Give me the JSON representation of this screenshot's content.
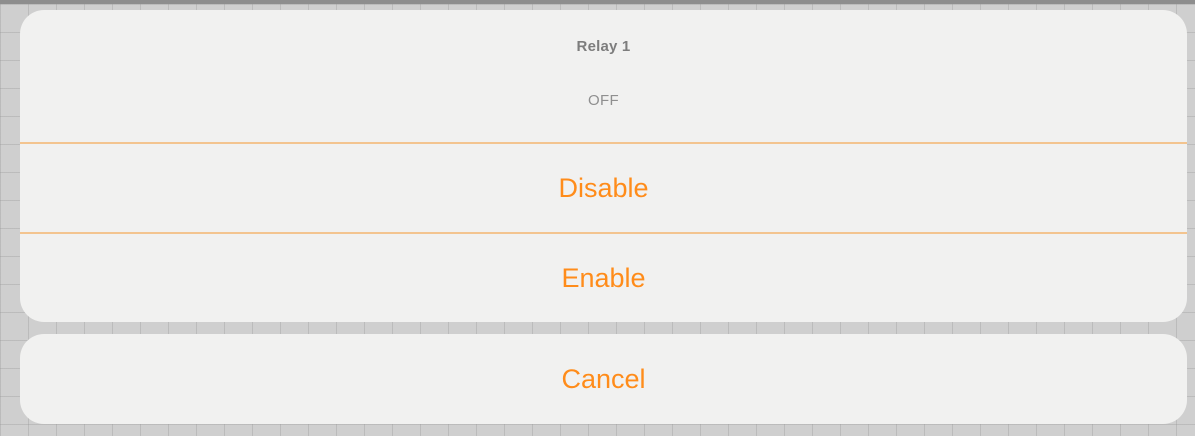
{
  "alert": {
    "title": "Relay 1",
    "message": "OFF",
    "actions": [
      {
        "label": "Disable"
      },
      {
        "label": "Enable"
      }
    ],
    "cancel_label": "Cancel"
  },
  "colors": {
    "accent": "#ff8c1a",
    "divider": "#f3c48f",
    "sheet_background": "#f1f1f0"
  }
}
